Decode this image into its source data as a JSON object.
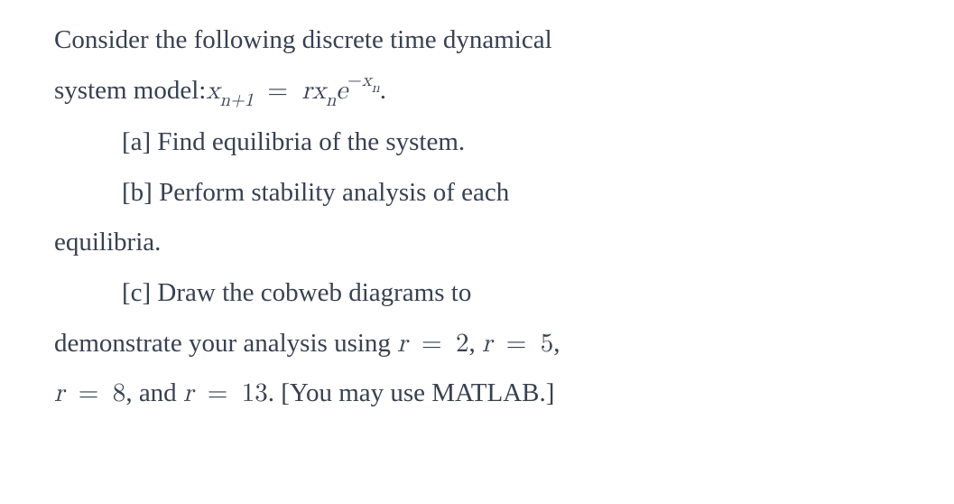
{
  "intro": {
    "line1": "Consider the following discrete time dynamical",
    "line2_prefix": "system model: ",
    "line2_suffix": " ."
  },
  "equation": {
    "lhs_var": "x",
    "lhs_sub": "n+1",
    "eq": " = ",
    "r": "r",
    "x": "x",
    "xn_sub": "n",
    "e": "e",
    "exp_minus": "−",
    "exp_x": "x",
    "exp_sub": "n"
  },
  "parts": {
    "a": "[a] Find equilibria of the system.",
    "b_line1": "[b] Perform stability analysis of each",
    "b_line2": "equilibria.",
    "c_line1": "[c] Draw the cobweb diagrams to",
    "c_line2_prefix": "demonstrate your analysis using ",
    "c_line3_prefix": "",
    "c_line3_mid": ", and ",
    "c_line3_suffix": ". [You may use MATLAB.]"
  },
  "rvals": {
    "r": "r",
    "eq": " = ",
    "v2": "2",
    "v5": "5",
    "v8": "8",
    "v13": "13",
    "comma": ", ",
    "comma_trail": ","
  }
}
